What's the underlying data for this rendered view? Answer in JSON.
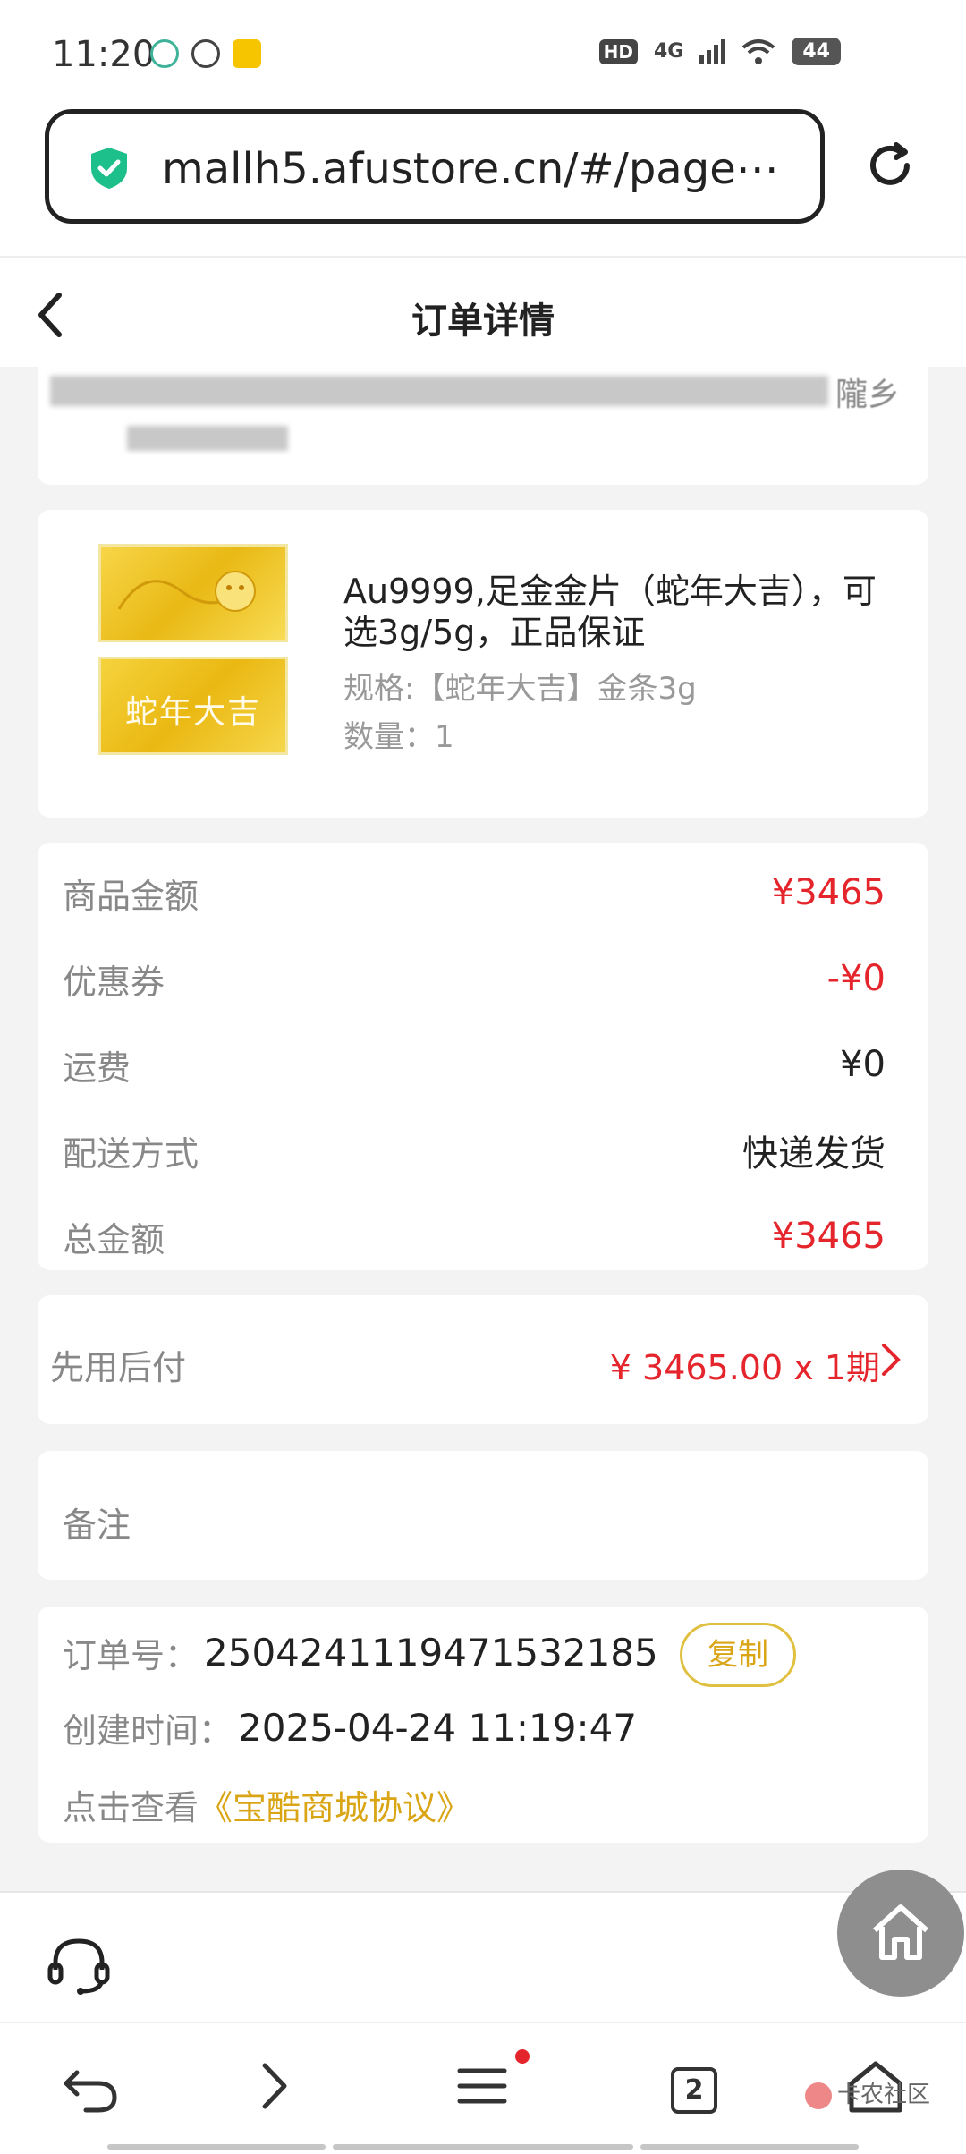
{
  "status_bar": {
    "time": "11:20",
    "hd": "HD",
    "network": "4G",
    "battery": "44"
  },
  "browser": {
    "url": "mallh5.afustore.cn/#/page⋯"
  },
  "header": {
    "title": "订单详情"
  },
  "address": {
    "visible_tail": "隴乡"
  },
  "product": {
    "image_text": "蛇年大吉",
    "name": "Au9999,足金金片（蛇年大吉），可选3g/5g，正品保证",
    "spec": "规格:【蛇年大吉】金条3g",
    "quantity": "数量：1"
  },
  "price": {
    "rows": [
      {
        "label": "商品金额",
        "value": "¥3465"
      },
      {
        "label": "优惠券",
        "value": "-¥0"
      },
      {
        "label": "运费",
        "value": "¥0"
      },
      {
        "label": "配送方式",
        "value": "快递发货"
      },
      {
        "label": "总金额",
        "value": "¥3465"
      }
    ]
  },
  "pay_later": {
    "label": "先用后付",
    "value": "¥ 3465.00 x 1期"
  },
  "remark": {
    "label": "备注"
  },
  "order_info": {
    "order_no_label": "订单号：",
    "order_no": "2504241119471532185",
    "copy_label": "复制",
    "created_label": "创建时间：",
    "created_time": "2025-04-24 11:19:47",
    "agreement_prefix": "点击查看",
    "agreement_link": "《宝酷商城协议》"
  },
  "nav": {
    "tab_count": "2",
    "watermark": "卡农社区"
  },
  "colors": {
    "accent_red": "#e5252c",
    "gold": "#d9a514",
    "secure_green": "#1dbf8a"
  }
}
